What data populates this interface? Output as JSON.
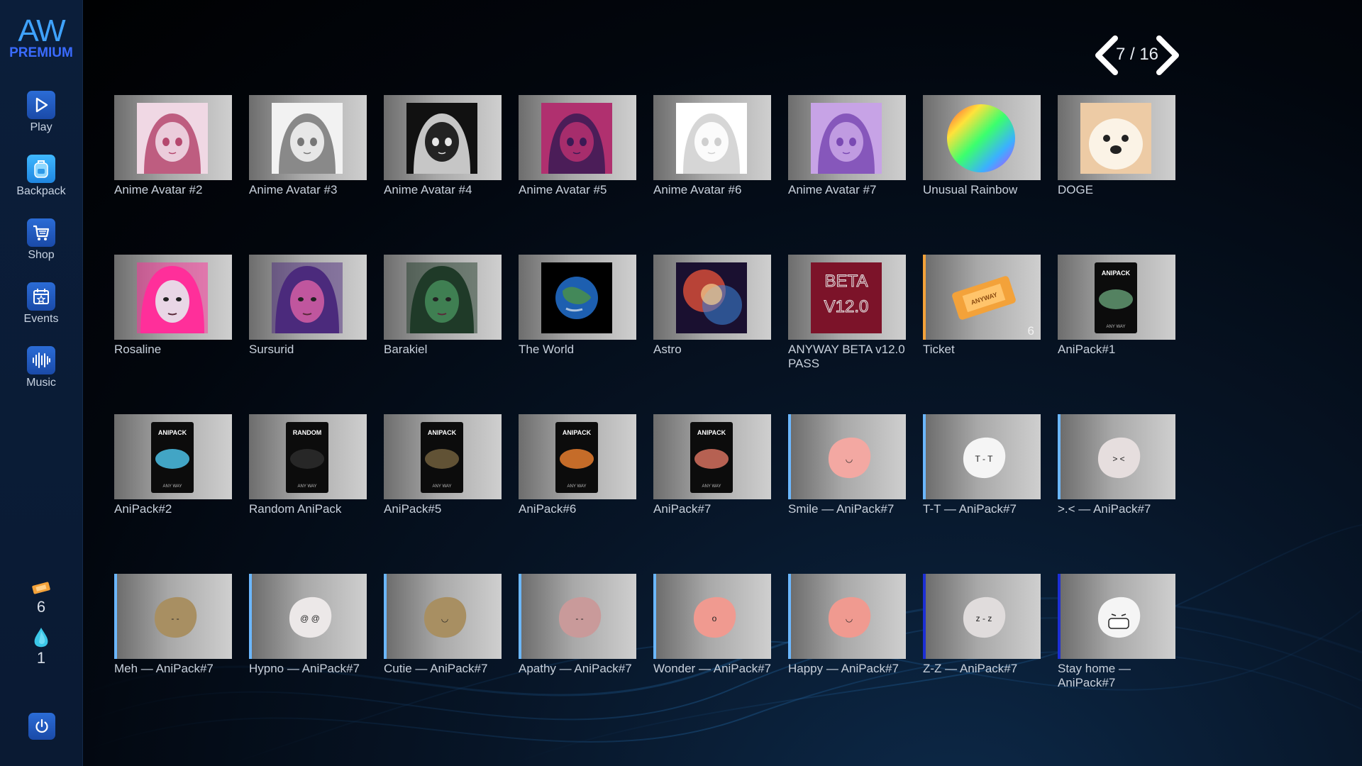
{
  "logo": {
    "main": "AW",
    "sub": "PREMIUM"
  },
  "nav": [
    {
      "label": "Play",
      "icon": "play-icon"
    },
    {
      "label": "Backpack",
      "icon": "backpack-icon"
    },
    {
      "label": "Shop",
      "icon": "cart-icon"
    },
    {
      "label": "Events",
      "icon": "calendar-icon"
    },
    {
      "label": "Music",
      "icon": "waveform-icon"
    }
  ],
  "wallet": {
    "tickets": "6",
    "gems": "1"
  },
  "pager": {
    "text": "7 / 16"
  },
  "items": [
    {
      "name": "Anime Avatar #2",
      "art": "anime-avatar",
      "colors": [
        "#f0d8e4",
        "#b5486e"
      ]
    },
    {
      "name": "Anime Avatar #3",
      "art": "anime-avatar",
      "colors": [
        "#f2f2f2",
        "#777777"
      ]
    },
    {
      "name": "Anime Avatar #4",
      "art": "anime-avatar",
      "colors": [
        "#111111",
        "#e6e6e6"
      ]
    },
    {
      "name": "Anime Avatar #5",
      "art": "anime-avatar",
      "colors": [
        "#b0306f",
        "#3a1a55"
      ]
    },
    {
      "name": "Anime Avatar #6",
      "art": "anime-avatar",
      "colors": [
        "#ffffff",
        "#cfcfcf"
      ]
    },
    {
      "name": "Anime Avatar #7",
      "art": "anime-avatar",
      "colors": [
        "#c7a3e6",
        "#7a4ab3"
      ]
    },
    {
      "name": "Unusual Rainbow",
      "art": "rainbow"
    },
    {
      "name": "DOGE",
      "art": "doge"
    },
    {
      "name": "Rosaline",
      "art": "portrait",
      "colors": [
        "#ff2f9a",
        "#e9d6e6"
      ]
    },
    {
      "name": "Sursurid",
      "art": "portrait",
      "colors": [
        "#4b2a7c",
        "#c0569e"
      ]
    },
    {
      "name": "Barakiel",
      "art": "portrait",
      "colors": [
        "#1f3a28",
        "#3f7f52"
      ]
    },
    {
      "name": "The World",
      "art": "earth"
    },
    {
      "name": "Astro",
      "art": "nebula"
    },
    {
      "name": "ANYWAY BETA v12.0 PASS",
      "art": "beta",
      "caption": "BETA V12.0"
    },
    {
      "name": "Ticket",
      "art": "ticket",
      "accent": "orange",
      "qty": "6",
      "caption": "ANYWAY"
    },
    {
      "name": "AniPack#1",
      "art": "pack",
      "caption": "ANIPACK",
      "colors": [
        "#5c8f6a"
      ]
    },
    {
      "name": "AniPack#2",
      "art": "pack",
      "caption": "ANIPACK",
      "colors": [
        "#48b6d9"
      ]
    },
    {
      "name": "Random AniPack",
      "art": "pack",
      "caption": "RANDOM",
      "colors": [
        "#2a2a2a"
      ]
    },
    {
      "name": "AniPack#5",
      "art": "pack",
      "caption": "ANIPACK",
      "colors": [
        "#6a5a3a"
      ]
    },
    {
      "name": "AniPack#6",
      "art": "pack",
      "caption": "ANIPACK",
      "colors": [
        "#d9772c"
      ]
    },
    {
      "name": "AniPack#7",
      "art": "pack",
      "caption": "ANIPACK",
      "colors": [
        "#c96a5a"
      ]
    },
    {
      "name": "Smile — AniPack#7",
      "art": "blob",
      "accent": "light",
      "colors": [
        "#f3a8a2"
      ],
      "face": "◡"
    },
    {
      "name": "T-T — AniPack#7",
      "art": "blob",
      "accent": "light",
      "colors": [
        "#f5f5f5"
      ],
      "face": "T - T"
    },
    {
      "name": ">.< — AniPack#7",
      "art": "blob",
      "accent": "light",
      "colors": [
        "#e6dede"
      ],
      "face": "> <"
    },
    {
      "name": "Meh — AniPack#7",
      "art": "blob",
      "accent": "light",
      "colors": [
        "#a88f62"
      ],
      "face": "- -"
    },
    {
      "name": "Hypno — AniPack#7",
      "art": "blob",
      "accent": "light",
      "colors": [
        "#ece8e8"
      ],
      "face": "@ @"
    },
    {
      "name": "Cutie — AniPack#7",
      "art": "blob",
      "accent": "light",
      "colors": [
        "#a88f62"
      ],
      "face": "◡"
    },
    {
      "name": "Apathy — AniPack#7",
      "art": "blob",
      "accent": "light",
      "colors": [
        "#c99a9a"
      ],
      "face": "- -"
    },
    {
      "name": "Wonder — AniPack#7",
      "art": "blob",
      "accent": "light",
      "colors": [
        "#f09a90"
      ],
      "face": "o"
    },
    {
      "name": "Happy — AniPack#7",
      "art": "blob",
      "accent": "light",
      "colors": [
        "#f09a90"
      ],
      "face": "◡"
    },
    {
      "name": "Z-Z — AniPack#7",
      "art": "blob",
      "accent": "dark",
      "colors": [
        "#e0dcdc"
      ],
      "face": "z - z"
    },
    {
      "name": "Stay home — AniPack#7",
      "art": "blob",
      "accent": "dark",
      "colors": [
        "#f5f5f5"
      ],
      "face": "mask"
    }
  ]
}
